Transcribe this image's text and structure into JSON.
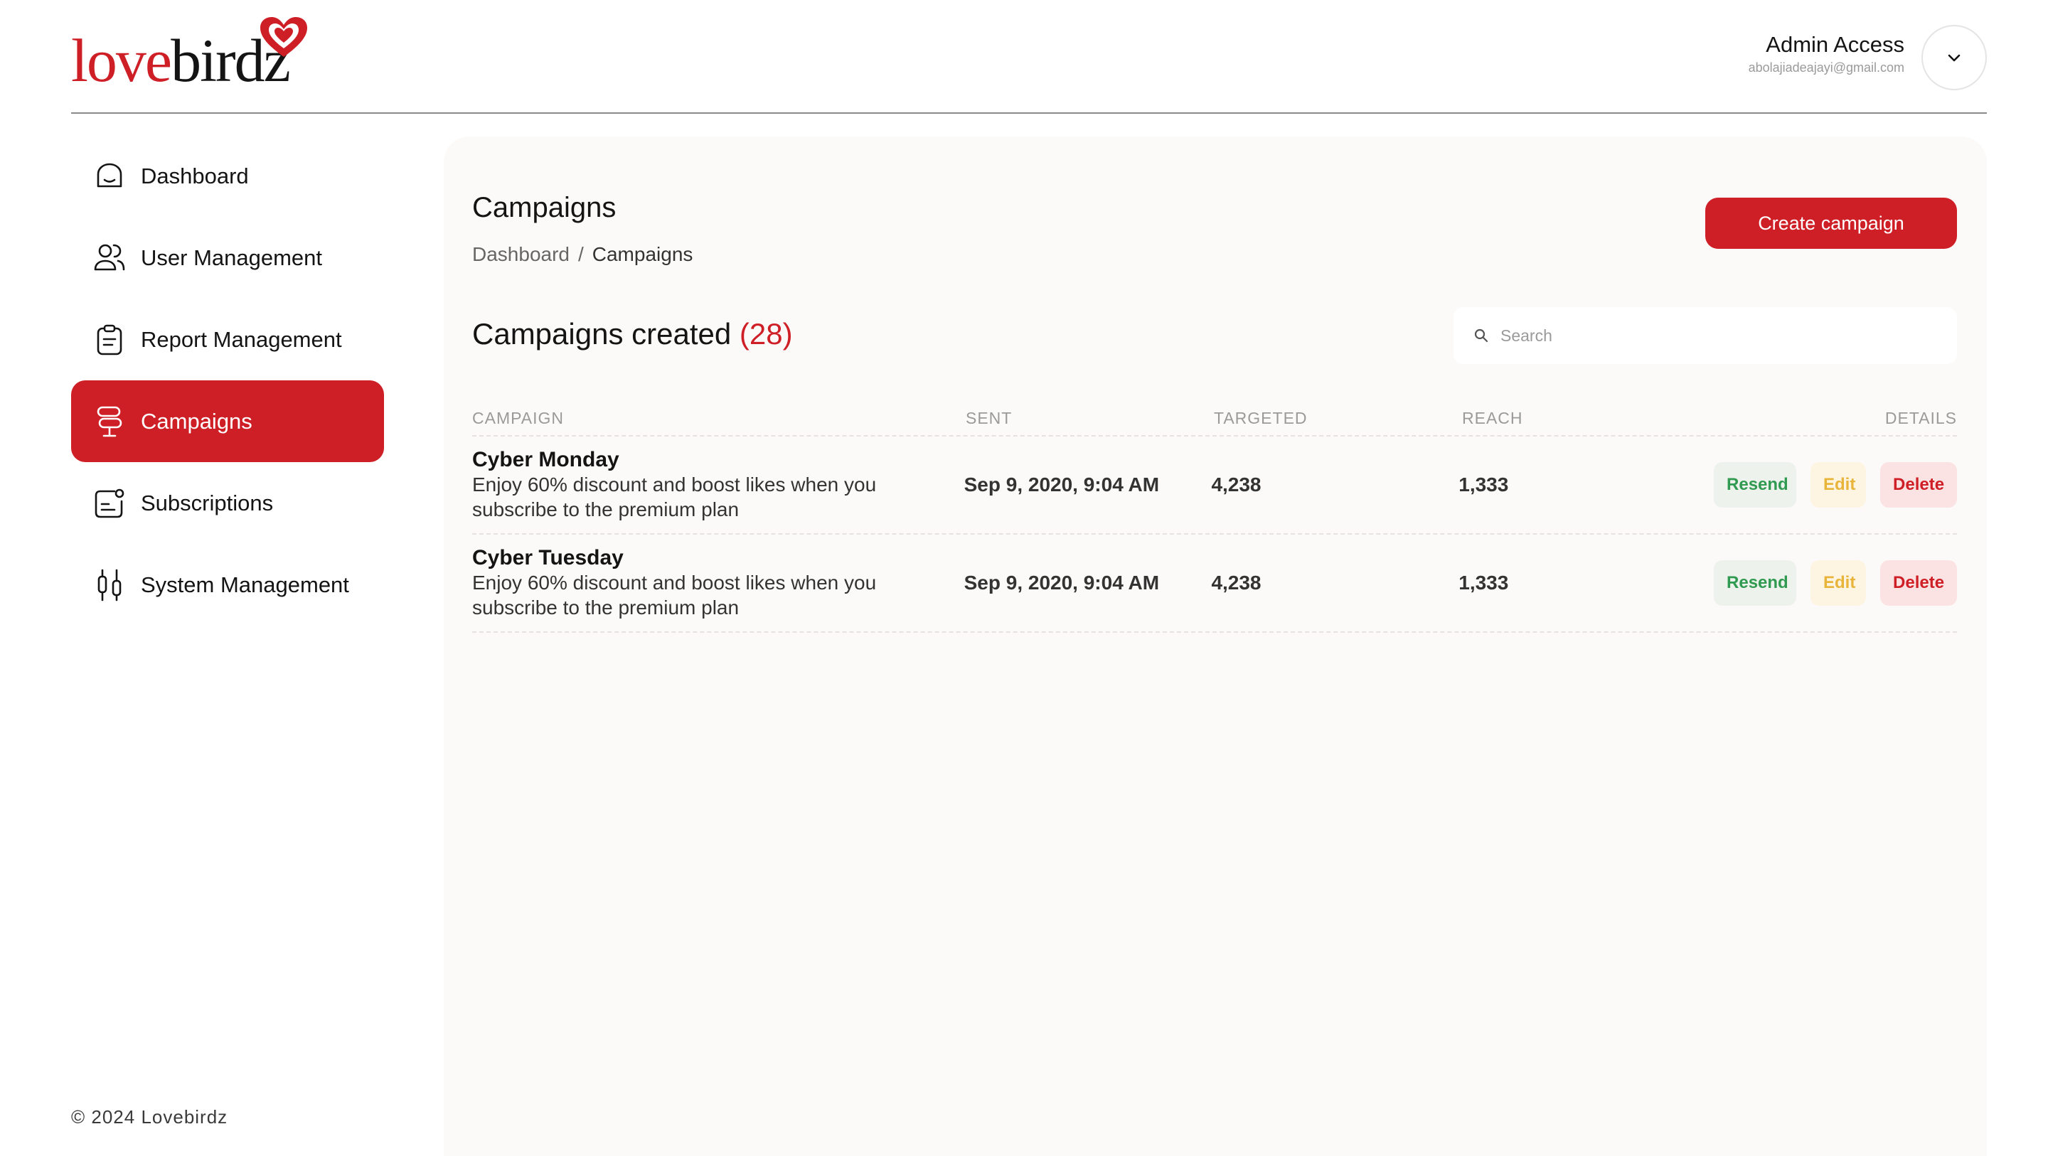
{
  "brand": {
    "logo_part1": "love",
    "logo_part2": "birdz",
    "accent": "#cf1f26"
  },
  "header": {
    "admin_title": "Admin Access",
    "admin_email": "abolajiadeajayi@gmail.com",
    "toggle_icon": "chevron-down-icon"
  },
  "sidebar": {
    "items": [
      {
        "label": "Dashboard",
        "icon": "home-icon",
        "active": false
      },
      {
        "label": "User Management",
        "icon": "users-icon",
        "active": false
      },
      {
        "label": "Report Management",
        "icon": "clipboard-icon",
        "active": false
      },
      {
        "label": "Campaigns",
        "icon": "campaign-icon",
        "active": true
      },
      {
        "label": "Subscriptions",
        "icon": "subscription-icon",
        "active": false
      },
      {
        "label": "System Management",
        "icon": "sliders-icon",
        "active": false
      }
    ],
    "footer": "© 2024 Lovebirdz"
  },
  "main": {
    "title": "Campaigns",
    "breadcrumb": {
      "root": "Dashboard",
      "separator": "/",
      "current": "Campaigns"
    },
    "create_label": "Create campaign",
    "section_title": "Campaigns created",
    "section_count": "(28)",
    "search_placeholder": "Search",
    "table": {
      "columns": [
        "CAMPAIGN",
        "SENT",
        "TARGETED",
        "REACH",
        "DETAILS"
      ],
      "rows": [
        {
          "name": "Cyber Monday",
          "description": "Enjoy 60% discount and boost likes when you subscribe to the premium plan",
          "sent": "Sep 9, 2020, 9:04 AM",
          "targeted": "4,238",
          "reach": "1,333"
        },
        {
          "name": "Cyber Tuesday",
          "description": "Enjoy 60% discount and boost likes when you subscribe to the premium plan",
          "sent": "Sep 9, 2020, 9:04 AM",
          "targeted": "4,238",
          "reach": "1,333"
        }
      ],
      "actions": {
        "resend": "Resend",
        "edit": "Edit",
        "delete": "Delete"
      }
    }
  }
}
